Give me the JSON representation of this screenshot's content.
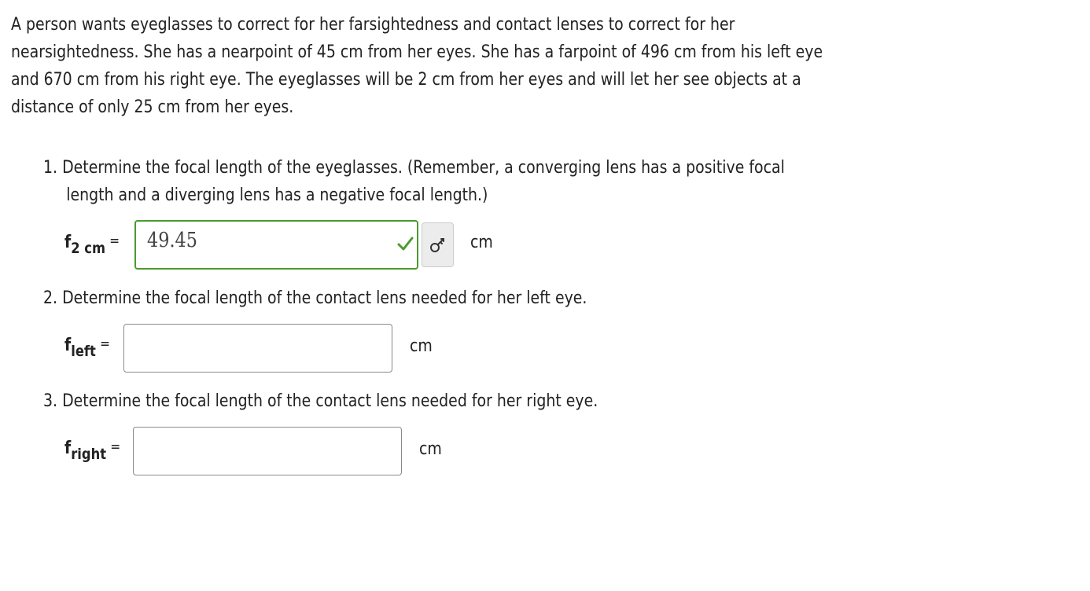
{
  "intro": {
    "line1": "A person wants eyeglasses to correct for her farsightedness and contact lenses to correct for her",
    "line2": "nearsightedness. She has a nearpoint of 45 cm from her eyes. She has a farpoint of 496 cm from his left eye",
    "line3": "and 670 cm from his right eye. The eyeglasses will be 2 cm from her eyes and will let her see objects at a",
    "line4": "distance of only 25 cm from her eyes."
  },
  "questions": [
    {
      "line1": "1. Determine the focal length of the eyeglasses. (Remember, a converging lens has a positive focal",
      "line2": "length and a diverging lens has a negative focal length.)",
      "var_symbol": "f",
      "var_sub": "2 cm",
      "equals": "=",
      "answer_value": "49.45",
      "status": "correct",
      "unit": "cm"
    },
    {
      "line1": "2. Determine the focal length of the contact lens needed for her left eye.",
      "var_symbol": "f",
      "var_sub": "left",
      "equals": "=",
      "answer_value": "",
      "unit": "cm"
    },
    {
      "line1": "3. Determine the focal length of the contact lens needed for her right eye.",
      "var_symbol": "f",
      "var_sub": "right",
      "equals": "=",
      "answer_value": "",
      "unit": "cm"
    }
  ],
  "icons": {
    "check": "check-icon",
    "key": "key-icon"
  },
  "colors": {
    "correct_border": "#4a9b2f",
    "check_mark": "#4a9b2f",
    "key_button_bg": "#ececec"
  }
}
